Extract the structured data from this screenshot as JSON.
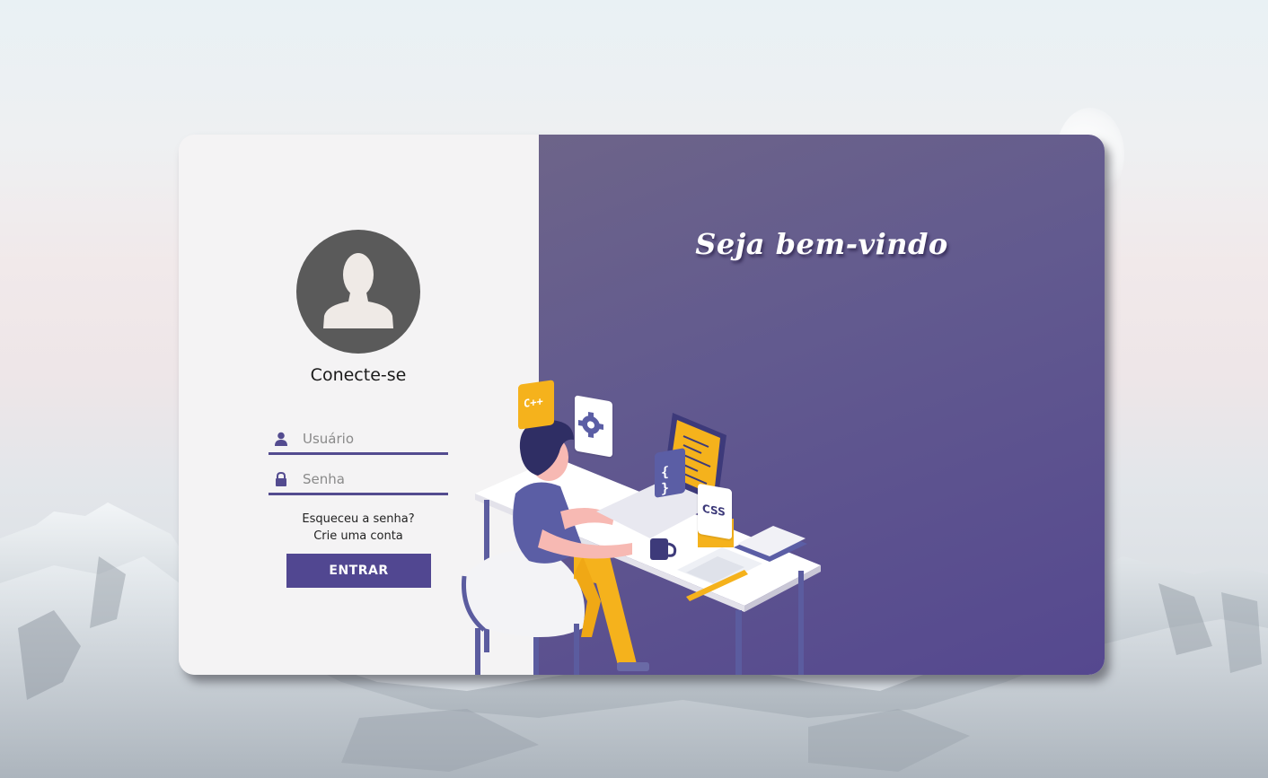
{
  "login": {
    "title": "Conecte-se",
    "username": {
      "placeholder": "Usuário",
      "value": ""
    },
    "password": {
      "placeholder": "Senha",
      "value": ""
    },
    "forgot_password_link": "Esqueceu a senha?",
    "create_account_link": "Crie uma conta",
    "submit_label": "ENTRAR"
  },
  "welcome": {
    "heading": "Seja bem-vindo"
  },
  "illustration": {
    "badges": [
      "C++",
      "{ }",
      "CSS"
    ]
  },
  "colors": {
    "accent": "#514791",
    "panel_gradient_start": "#6d6489",
    "panel_gradient_end": "#55488f",
    "left_panel_bg": "#f4f3f4",
    "avatar_bg": "#5a5a5a",
    "highlight_yellow": "#f5b21c"
  },
  "icons": {
    "user": "user-icon",
    "lock": "lock-icon",
    "avatar": "avatar-icon"
  }
}
